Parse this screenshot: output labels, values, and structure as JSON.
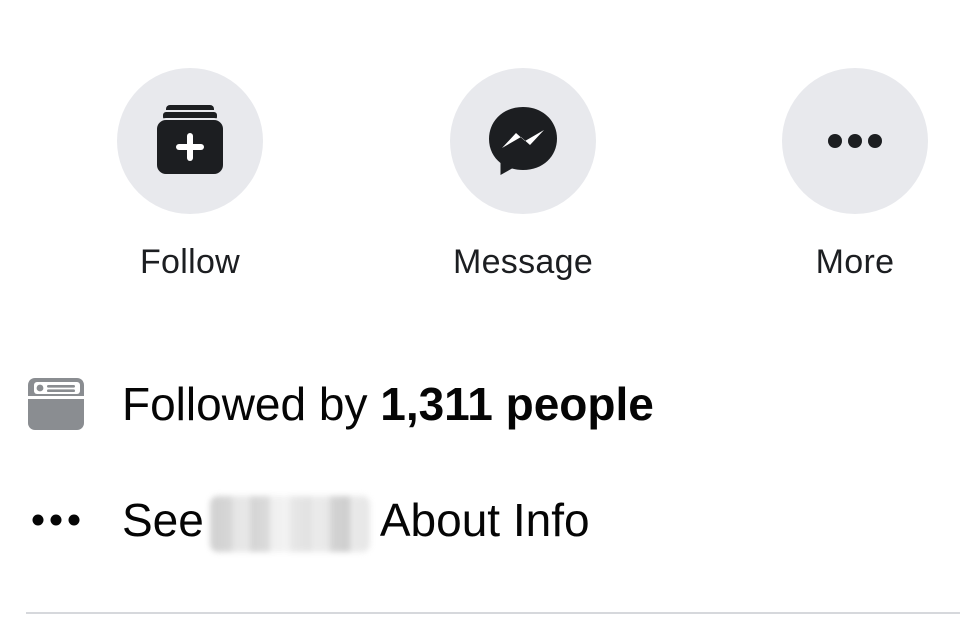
{
  "actions": {
    "follow": {
      "label": "Follow",
      "icon": "follow-add-icon"
    },
    "message": {
      "label": "Message",
      "icon": "messenger-icon"
    },
    "more": {
      "label": "More",
      "icon": "more-dots-icon"
    }
  },
  "info": {
    "followers": {
      "prefix": "Followed by ",
      "count": "1,311 people",
      "icon": "id-card-icon"
    },
    "about": {
      "see": "See",
      "suffix": "About Info",
      "icon": "ellipsis-icon"
    }
  },
  "colors": {
    "circle_bg": "#e8e9ed",
    "icon_dark": "#1c1e21",
    "icon_gray": "#8a8d91",
    "text": "#050505",
    "divider": "#d6d8dc"
  }
}
